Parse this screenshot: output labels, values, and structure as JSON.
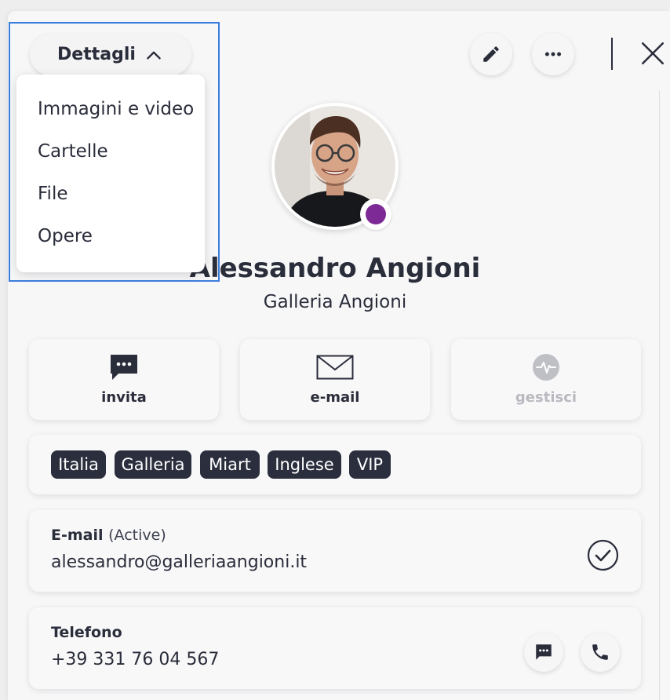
{
  "header": {
    "details_button_label": "Dettagli",
    "icons": {
      "details_toggle": "chevron-up-icon",
      "edit": "pencil-icon",
      "more": "more-horizontal-icon",
      "close": "close-icon"
    }
  },
  "dropdown": {
    "items": [
      {
        "label": "Immagini e video"
      },
      {
        "label": "Cartelle"
      },
      {
        "label": "File"
      },
      {
        "label": "Opere"
      }
    ]
  },
  "profile": {
    "name": "Alessandro Angioni",
    "company": "Galleria Angioni",
    "status_color": "#7e2a96"
  },
  "actions": [
    {
      "label": "invita",
      "icon": "chat-bubble-icon",
      "enabled": true
    },
    {
      "label": "e-mail",
      "icon": "envelope-icon",
      "enabled": true
    },
    {
      "label": "gestisci",
      "icon": "activity-icon",
      "enabled": false
    }
  ],
  "tags": [
    "Italia",
    "Galleria",
    "Miart",
    "Inglese",
    "VIP"
  ],
  "email": {
    "label": "E-mail",
    "status": "(Active)",
    "value": "alessandro@galleriaangioni.it",
    "icon": "check-circle-icon"
  },
  "phone": {
    "label": "Telefono",
    "value": "+39 331 76 04 567",
    "icons": [
      "message-icon",
      "phone-icon"
    ]
  },
  "colors": {
    "text": "#2a2d3a",
    "tag_bg": "#2b2e3d",
    "selection": "#3b7ddd",
    "disabled": "#b9bac0"
  }
}
